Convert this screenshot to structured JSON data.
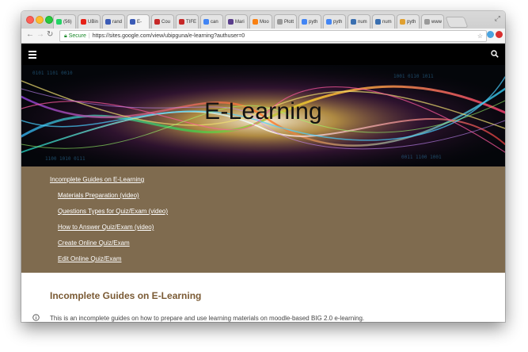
{
  "browser": {
    "tabs": [
      {
        "label": "(56)",
        "icon": "whatsapp-icon",
        "color": "#25d366",
        "active": false
      },
      {
        "label": "UBin",
        "icon": "youtube-icon",
        "color": "#e62117",
        "active": false
      },
      {
        "label": "rand",
        "icon": "sites-icon",
        "color": "#3b5bb6",
        "active": false
      },
      {
        "label": "E-",
        "icon": "sites-icon",
        "color": "#3b5bb6",
        "active": true
      },
      {
        "label": "Cou",
        "icon": "shield-icon",
        "color": "#c62828",
        "active": false
      },
      {
        "label": "TIFE",
        "icon": "shield-icon",
        "color": "#c62828",
        "active": false
      },
      {
        "label": "can",
        "icon": "google-icon",
        "color": "#4285f4",
        "active": false
      },
      {
        "label": "Mari",
        "icon": "mm-icon",
        "color": "#5a3e8c",
        "active": false
      },
      {
        "label": "Moo",
        "icon": "moodle-icon",
        "color": "#f98012",
        "active": false
      },
      {
        "label": "Plott",
        "icon": "pt-icon",
        "color": "#9a9a9a",
        "active": false
      },
      {
        "label": "pyth",
        "icon": "google-icon",
        "color": "#4285f4",
        "active": false
      },
      {
        "label": "pyth",
        "icon": "google-icon",
        "color": "#4285f4",
        "active": false
      },
      {
        "label": "num",
        "icon": "python-icon",
        "color": "#3a6fb0",
        "active": false
      },
      {
        "label": "num",
        "icon": "python-icon",
        "color": "#3a6fb0",
        "active": false
      },
      {
        "label": "pyth",
        "icon": "pen-icon",
        "color": "#e0a030",
        "active": false
      },
      {
        "label": "www",
        "icon": "document-icon",
        "color": "#9a9a9a",
        "active": false
      }
    ],
    "address": {
      "secure_label": "Secure",
      "url": "https://sites.google.com/view/ubipguna/e-learning?authuser=0"
    }
  },
  "banner": {
    "title": "E-Learning"
  },
  "nav": {
    "links": [
      {
        "label": "Incomplete Guides on E-Learning",
        "level": 0
      },
      {
        "label": "Materials Preparation (video)",
        "level": 1
      },
      {
        "label": "Questions Types for Quiz/Exam (video)",
        "level": 1
      },
      {
        "label": "How to Answer Quiz/Exam (video)",
        "level": 1
      },
      {
        "label": "Create Online Quiz/Exam",
        "level": 1
      },
      {
        "label": "Edit Online Quiz/Exam",
        "level": 1
      }
    ]
  },
  "content": {
    "heading": "Incomplete Guides on E-Learning",
    "paragraph": "This is an incomplete guides on how to prepare and use learning materials on moodle-based BIG 2.0 e-learning."
  },
  "colors": {
    "nav_background": "#7f6b4f",
    "heading": "#7a5a34",
    "site_header": "#000000"
  }
}
